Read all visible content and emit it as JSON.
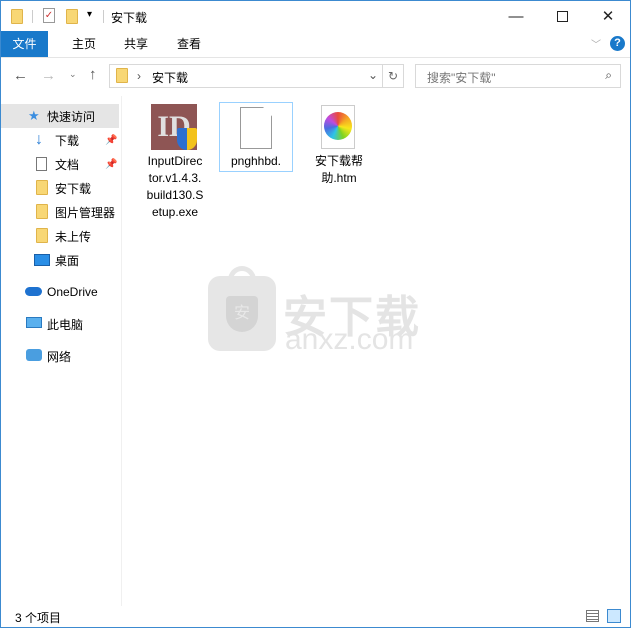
{
  "window": {
    "title": "安下载",
    "minimize_icon": "minimize-icon",
    "maximize_icon": "maximize-icon",
    "close_icon": "close-icon"
  },
  "ribbon": {
    "tabs": [
      {
        "label": "文件"
      },
      {
        "label": "主页"
      },
      {
        "label": "共享"
      },
      {
        "label": "查看"
      }
    ]
  },
  "address": {
    "path": "安下载",
    "search_placeholder": "搜索\"安下载\""
  },
  "sidebar": {
    "items": [
      {
        "label": "快速访问",
        "icon": "star-icon",
        "selected": true
      },
      {
        "label": "下载",
        "icon": "download-icon",
        "pinned": true
      },
      {
        "label": "文档",
        "icon": "document-icon",
        "pinned": true
      },
      {
        "label": "安下载",
        "icon": "folder-icon"
      },
      {
        "label": "图片管理器",
        "icon": "folder-icon"
      },
      {
        "label": "未上传",
        "icon": "folder-icon"
      },
      {
        "label": "桌面",
        "icon": "desktop-icon"
      },
      {
        "label": "OneDrive",
        "icon": "cloud-icon"
      },
      {
        "label": "此电脑",
        "icon": "computer-icon"
      },
      {
        "label": "网络",
        "icon": "network-icon"
      }
    ]
  },
  "files": [
    {
      "name_lines": [
        "InputDirec",
        "tor.v1.4.3.",
        "build130.S",
        "etup.exe"
      ],
      "icon": "installer-icon"
    },
    {
      "name_lines": [
        "pnghhbd."
      ],
      "icon": "blank-file-icon",
      "selected": true
    },
    {
      "name_lines": [
        "安下载帮",
        "助.htm"
      ],
      "icon": "html-file-icon"
    }
  ],
  "watermark": {
    "text": "安下载",
    "sub": "anxz.com"
  },
  "status": {
    "count": "3 个项目"
  },
  "colors": {
    "accent": "#1979ca",
    "selection": "#cce8ff"
  }
}
